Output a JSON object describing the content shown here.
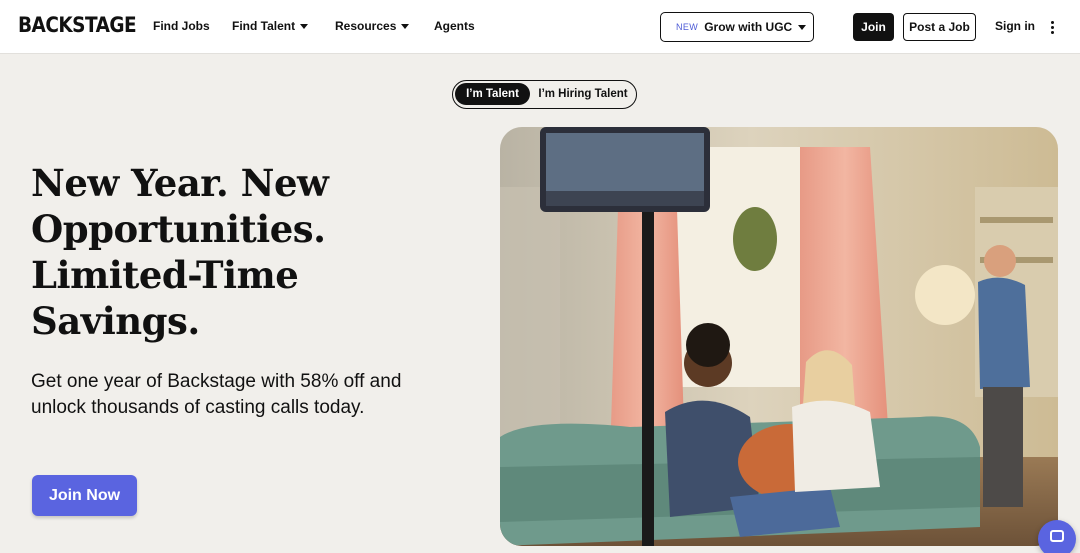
{
  "header": {
    "logo": "BACKSTAGE",
    "nav": [
      {
        "label": "Find Jobs",
        "dropdown": false
      },
      {
        "label": "Find Talent",
        "dropdown": true
      },
      {
        "label": "Resources",
        "dropdown": true
      },
      {
        "label": "Agents",
        "dropdown": false
      }
    ],
    "promo": {
      "badge": "NEW",
      "label": "Grow with UGC"
    },
    "join_label": "Join",
    "post_job_label": "Post a Job",
    "sign_in_label": "Sign in"
  },
  "audience_toggle": {
    "options": [
      "I’m Talent",
      "I’m Hiring Talent"
    ],
    "selected": "I’m Talent"
  },
  "hero": {
    "headline_lines": [
      "New Year. New",
      "Opportunities.",
      "Limited-Time",
      "Savings."
    ],
    "subheading": "Get one year of Backstage with 58% off and unlock thousands of casting calls today.",
    "cta_label": "Join Now"
  },
  "colors": {
    "accent": "#5a64e0",
    "background": "#f1efeb",
    "text": "#111111"
  },
  "icons": [
    "caret-down-icon",
    "kebab-menu-icon",
    "chat-icon"
  ]
}
